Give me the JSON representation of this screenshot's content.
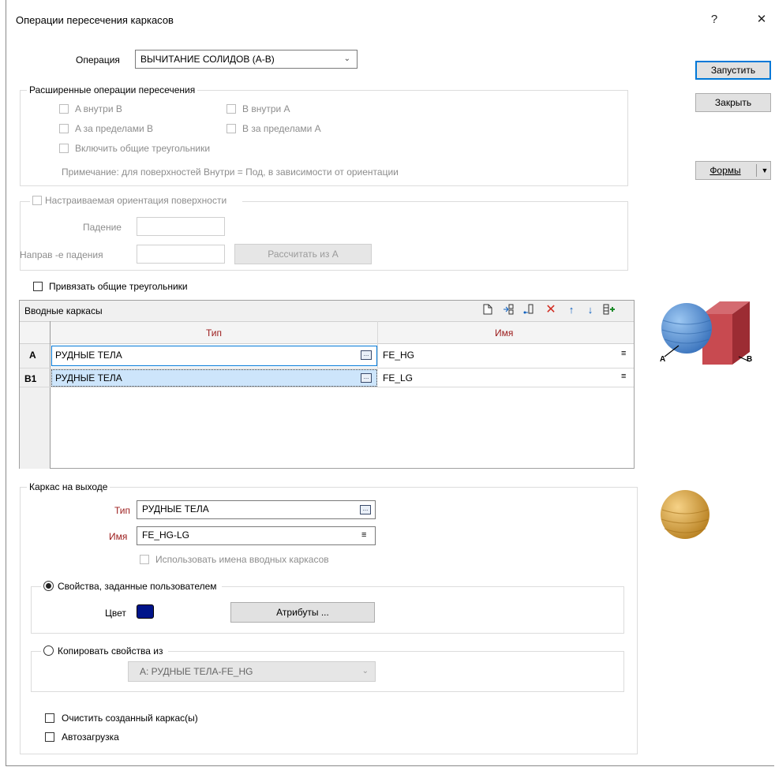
{
  "window": {
    "title": "Операции пересечения каркасов",
    "help_icon": "?",
    "close_icon": "✕"
  },
  "operation": {
    "label": "Операция",
    "value": "ВЫЧИТАНИЕ СОЛИДОВ (A-B)"
  },
  "buttons": {
    "run": "Запустить",
    "close": "Закрыть",
    "forms": "Формы"
  },
  "advanced": {
    "title": "Расширенные операции пересечения",
    "a_inside_b": "A внутри B",
    "b_inside_a": "B внутри A",
    "a_outside_b": "A за пределами B",
    "b_outside_a": "B за пределами A",
    "include_common": "Включить общие треугольники",
    "note": "Примечание: для поверхностей Внутри = Под, в зависимости от ориентации"
  },
  "orientation": {
    "title": "Настраиваемая ориентация поверхности",
    "dip_label": "Падение",
    "dip_dir_label": "Направ -е падения",
    "calc_button": "Рассчитать из A"
  },
  "snap_common": "Привязать общие треугольники",
  "inputs": {
    "title": "Вводные каркасы",
    "columns": [
      "Тип",
      "Имя"
    ],
    "rows": [
      {
        "id": "A",
        "type": "РУДНЫЕ ТЕЛА",
        "name": "FE_HG"
      },
      {
        "id": "B1",
        "type": "РУДНЫЕ ТЕЛА",
        "name": "FE_LG"
      }
    ]
  },
  "diagram": {
    "label_a": "A",
    "label_b": "B",
    "colors": {
      "sphere": "#4f8fd6",
      "cube": "#c84a50",
      "result": "#e0a83c"
    }
  },
  "output": {
    "title": "Каркас на выходе",
    "type_label": "Тип",
    "type_value": "РУДНЫЕ ТЕЛА",
    "name_label": "Имя",
    "name_value": "FE_HG-LG",
    "use_input_names": "Использовать имена вводных каркасов",
    "user_props": "Свойства, заданные пользователем",
    "color_label": "Цвет",
    "color_value": "#00148a",
    "attributes_button": "Атрибуты ...",
    "copy_props": "Копировать свойства из",
    "copy_source": "A: РУДНЫЕ ТЕЛА-FE_HG",
    "clear_created": "Очистить созданный каркас(ы)",
    "autoload": "Автозагрузка"
  }
}
